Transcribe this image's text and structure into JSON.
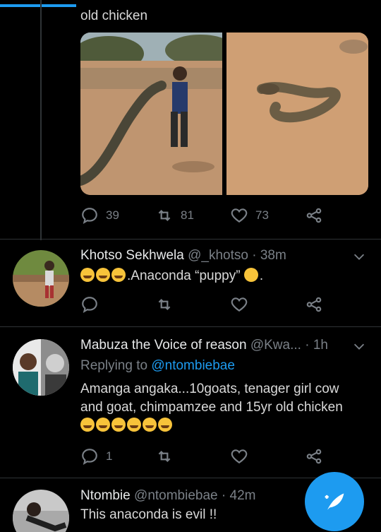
{
  "tweet1": {
    "text_tail": "old chicken",
    "actions": {
      "replies": "39",
      "retweets": "81",
      "likes": "73"
    }
  },
  "reply1": {
    "name": "Khotso Sekhwela",
    "handle": "@_khotso",
    "sep": "·",
    "time": "38m",
    "text": ".Anaconda “puppy” ",
    "text_tail": "."
  },
  "reply2": {
    "name": "Mabuza the Voice of reason",
    "handle": "@Kwa...",
    "sep": "·",
    "time": "1h",
    "replying_label": "Replying to",
    "replying_handle": "@ntombiebae",
    "text_line1": "Amanga angaka...10goats, tenager girl cow",
    "text_line2": "and goat, chimpamzee and 15yr old chicken",
    "reply_count": "1"
  },
  "reply3": {
    "name": "Ntombie",
    "handle": "@ntombiebae",
    "sep": "·",
    "time": "42m",
    "text": "This anaconda is evil !!"
  },
  "colors": {
    "accent": "#1d9bf0",
    "background": "#000000",
    "muted": "#7a8087"
  },
  "icons": {
    "reply": "comment-icon",
    "retweet": "retweet-icon",
    "like": "heart-icon",
    "share": "share-icon",
    "more": "chevron-down-icon",
    "compose": "compose-feather-icon"
  }
}
